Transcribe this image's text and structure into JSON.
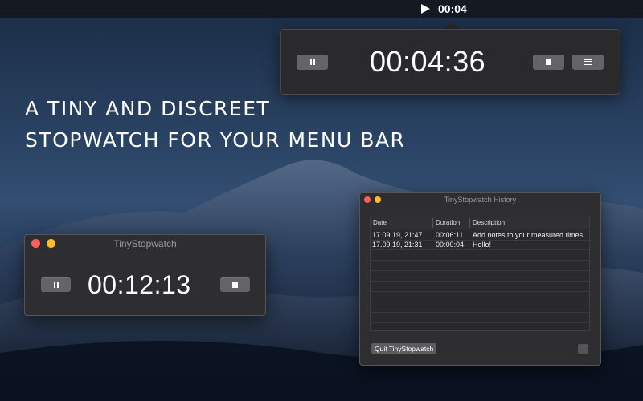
{
  "menubar": {
    "play_icon": "play-icon",
    "elapsed": "00:04"
  },
  "popover": {
    "time": "00:04:36",
    "pause_icon": "pause-icon",
    "stop_icon": "stop-icon",
    "history_icon": "list-icon"
  },
  "headline": {
    "line1": "A TINY AND DISCREET",
    "line2": "STOPWATCH FOR YOUR MENU BAR"
  },
  "stopwatch_window": {
    "title": "TinyStopwatch",
    "time": "00:12:13",
    "pause_icon": "pause-icon",
    "stop_icon": "stop-icon"
  },
  "history_window": {
    "title": "TinyStopwatch History",
    "columns": [
      "Date",
      "Duration",
      "Description"
    ],
    "rows": [
      {
        "date": "17.09.19, 21:47",
        "duration": "00:06:11",
        "description": "Add notes to your measured times"
      },
      {
        "date": "17.09.19, 21:31",
        "duration": "00:00:04",
        "description": "Hello!"
      }
    ],
    "quit_label": "Quit TinyStopwatch",
    "settings_icon": "settings-icon"
  },
  "colors": {
    "close": "#fe5f57",
    "minimize": "#febc2e",
    "window_bg": "#2e2e30",
    "button_bg": "#646466"
  }
}
